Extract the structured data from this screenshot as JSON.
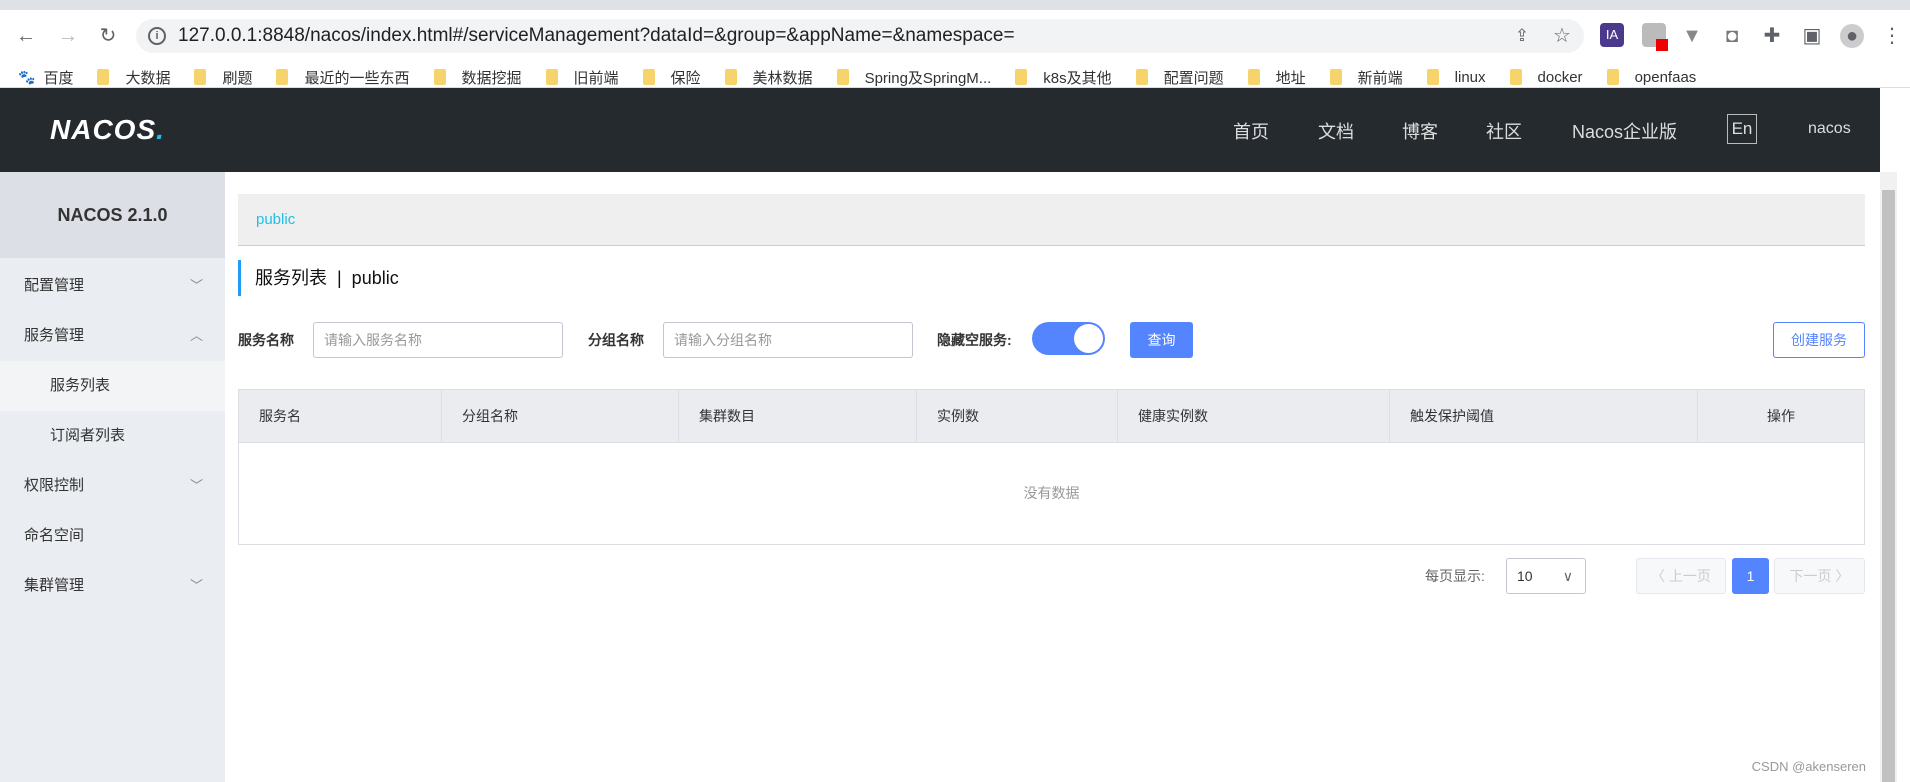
{
  "browser": {
    "url": "127.0.0.1:8848/nacos/index.html#/serviceManagement?dataId=&group=&appName=&namespace=",
    "bookmarks": [
      "百度",
      "大数据",
      "刷题",
      "最近的一些东西",
      "数据挖掘",
      "旧前端",
      "保险",
      "美林数据",
      "Spring及SpringM...",
      "k8s及其他",
      "配置问题",
      "地址",
      "新前端",
      "linux",
      "docker",
      "openfaas"
    ],
    "ext_ia": "IA"
  },
  "header": {
    "logo": "NACOS",
    "logo_dot": ".",
    "nav": [
      "首页",
      "文档",
      "博客",
      "社区",
      "Nacos企业版"
    ],
    "lang": "En",
    "user": "nacos"
  },
  "sidebar": {
    "title": "NACOS 2.1.0",
    "items": [
      {
        "label": "配置管理",
        "chev": "﹀"
      },
      {
        "label": "服务管理",
        "chev": "︿"
      },
      {
        "label": "服务列表"
      },
      {
        "label": "订阅者列表"
      },
      {
        "label": "权限控制",
        "chev": "﹀"
      },
      {
        "label": "命名空间"
      },
      {
        "label": "集群管理",
        "chev": "﹀"
      }
    ]
  },
  "main": {
    "breadcrumb": "public",
    "title": "服务列表  |  public",
    "filters": {
      "service_label": "服务名称",
      "service_placeholder": "请输入服务名称",
      "group_label": "分组名称",
      "group_placeholder": "请输入分组名称",
      "hide_empty_label": "隐藏空服务:",
      "hide_empty": true,
      "query": "查询",
      "create": "创建服务"
    },
    "table": {
      "columns": [
        "服务名",
        "分组名称",
        "集群数目",
        "实例数",
        "健康实例数",
        "触发保护阈值",
        "操作"
      ],
      "empty": "没有数据"
    },
    "pagination": {
      "label": "每页显示:",
      "page_size": "10",
      "prev": "〈 上一页",
      "current": "1",
      "next": "下一页 〉"
    }
  },
  "watermark": "CSDN @akenseren"
}
